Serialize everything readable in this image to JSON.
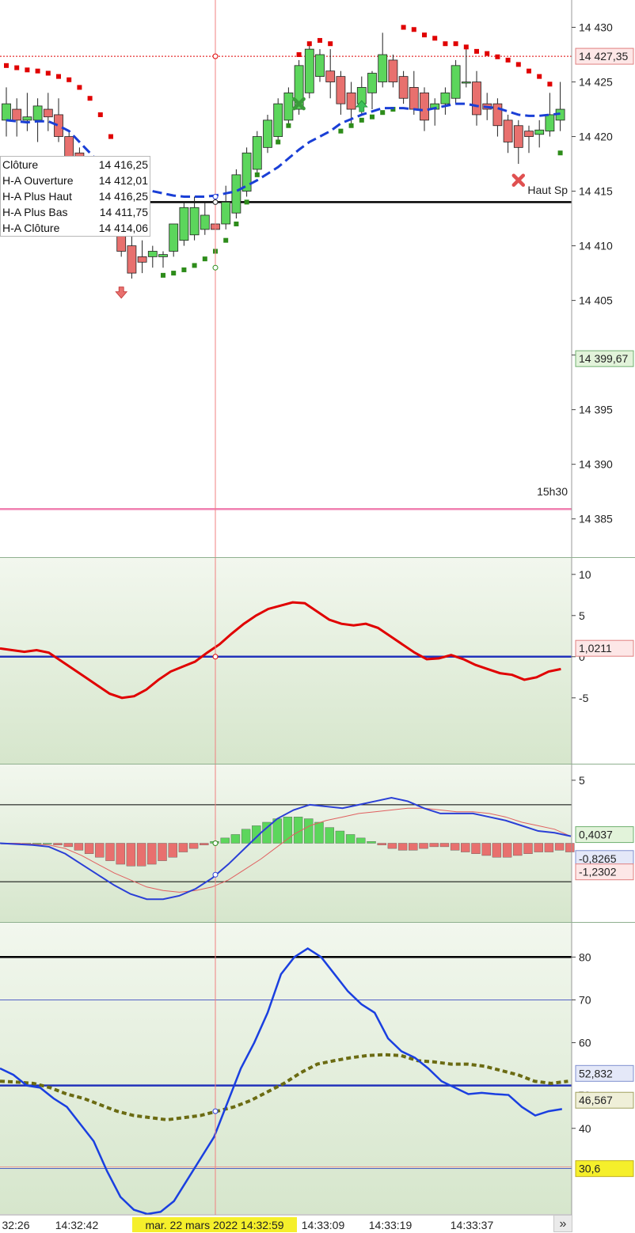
{
  "colors": {
    "bull": "#5cd65c",
    "bear": "#e8706e",
    "sar_bear": "#e00000",
    "sar_bull": "#2d8c1a",
    "ma": "#1a3fd6",
    "osc": "#e00000",
    "zero": "#2233bb",
    "pink": "#f080b0",
    "crosshair": "#f08080"
  },
  "price_panel": {
    "price_ticks": [
      "14 430",
      "14 425",
      "14 420",
      "14 415",
      "14 410",
      "14 405",
      "14 400",
      "14 395",
      "14 390",
      "14 385"
    ],
    "top_badge": "14 427,35",
    "mid_badge": "14 399,67",
    "pink_label": "15h30",
    "black_line_label": "Haut Sp"
  },
  "tooltip": {
    "rows": [
      {
        "label": "Clôture",
        "value": "14 416,25"
      },
      {
        "label": "H-A Ouverture",
        "value": "14 412,01"
      },
      {
        "label": "H-A Plus Haut",
        "value": "14 416,25"
      },
      {
        "label": "H-A Plus Bas",
        "value": "14 411,75"
      },
      {
        "label": "H-A Clôture",
        "value": "14 414,06"
      }
    ]
  },
  "osc_panel": {
    "ticks": [
      "10",
      "5",
      "0",
      "-5"
    ],
    "badge": "1,0211"
  },
  "macd_panel": {
    "ticks": [
      "5"
    ],
    "badge_green": "0,4037",
    "badge_blue": "-0,8265",
    "badge_red": "-1,2302"
  },
  "rsi_panel": {
    "ticks": [
      "80",
      "70",
      "60",
      "50",
      "40"
    ],
    "badge_blue": "52,832",
    "badge_olive": "46,567",
    "badge_yellow": "30,6",
    "level_label": "50"
  },
  "time_axis": {
    "labels": [
      "32:26",
      "14:32:42",
      "14:33:09",
      "14:33:19",
      "14:33:37"
    ],
    "crosshair_label": "mar. 22 mars 2022 14:32:59"
  },
  "nav": {
    "more_label": "»"
  },
  "chart_data": [
    {
      "type": "candlestick",
      "ylim": [
        14381.5,
        14432.5
      ],
      "candles": [
        {
          "o": 14421.5,
          "h": 14424.5,
          "l": 14420,
          "c": 14423
        },
        {
          "o": 14422.5,
          "h": 14423.5,
          "l": 14420,
          "c": 14421.5
        },
        {
          "o": 14421.5,
          "h": 14424,
          "l": 14420.5,
          "c": 14421.8
        },
        {
          "o": 14421.5,
          "h": 14423.5,
          "l": 14419.5,
          "c": 14422.8
        },
        {
          "o": 14422.5,
          "h": 14424,
          "l": 14420.5,
          "c": 14421.8
        },
        {
          "o": 14422,
          "h": 14423.5,
          "l": 14419.5,
          "c": 14420
        },
        {
          "o": 14420,
          "h": 14420.5,
          "l": 14415,
          "c": 14416.5
        },
        {
          "o": 14418.5,
          "h": 14419,
          "l": 14416,
          "c": 14416.2
        },
        {
          "o": 14417,
          "h": 14417.5,
          "l": 14413.5,
          "c": 14414
        },
        {
          "o": 14416,
          "h": 14416.5,
          "l": 14413,
          "c": 14413.5
        },
        {
          "o": 14414.5,
          "h": 14416,
          "l": 14413,
          "c": 14413.8
        },
        {
          "o": 14412,
          "h": 14413,
          "l": 14409,
          "c": 14409.5
        },
        {
          "o": 14410,
          "h": 14411,
          "l": 14407,
          "c": 14407.5
        },
        {
          "o": 14409,
          "h": 14410.5,
          "l": 14407.5,
          "c": 14408.5
        },
        {
          "o": 14409,
          "h": 14410,
          "l": 14408,
          "c": 14409.5
        },
        {
          "o": 14409,
          "h": 14409.5,
          "l": 14408,
          "c": 14409.2
        },
        {
          "o": 14409.5,
          "h": 14412,
          "l": 14409,
          "c": 14412
        },
        {
          "o": 14410.5,
          "h": 14414,
          "l": 14410,
          "c": 14413.5
        },
        {
          "o": 14411,
          "h": 14414.5,
          "l": 14410.5,
          "c": 14413.5
        },
        {
          "o": 14411.5,
          "h": 14414,
          "l": 14411,
          "c": 14412.8
        },
        {
          "o": 14412,
          "h": 14413,
          "l": 14409.5,
          "c": 14411.5
        },
        {
          "o": 14412,
          "h": 14415.5,
          "l": 14411.5,
          "c": 14414
        },
        {
          "o": 14413,
          "h": 14417,
          "l": 14412.5,
          "c": 14416.5
        },
        {
          "o": 14415,
          "h": 14419,
          "l": 14414.5,
          "c": 14418.5
        },
        {
          "o": 14417,
          "h": 14420.5,
          "l": 14416.5,
          "c": 14420
        },
        {
          "o": 14419,
          "h": 14422,
          "l": 14418.5,
          "c": 14421.5
        },
        {
          "o": 14420,
          "h": 14423.5,
          "l": 14419.5,
          "c": 14423
        },
        {
          "o": 14421.5,
          "h": 14424.5,
          "l": 14421,
          "c": 14424
        },
        {
          "o": 14422.5,
          "h": 14427,
          "l": 14422,
          "c": 14426.5
        },
        {
          "o": 14424,
          "h": 14428.5,
          "l": 14423.5,
          "c": 14428
        },
        {
          "o": 14425.5,
          "h": 14428,
          "l": 14425,
          "c": 14427.5
        },
        {
          "o": 14426,
          "h": 14428,
          "l": 14423.5,
          "c": 14425
        },
        {
          "o": 14425.5,
          "h": 14426,
          "l": 14422,
          "c": 14423
        },
        {
          "o": 14424,
          "h": 14425,
          "l": 14421,
          "c": 14422.5
        },
        {
          "o": 14423,
          "h": 14425.5,
          "l": 14422,
          "c": 14424.5
        },
        {
          "o": 14424,
          "h": 14426,
          "l": 14422.5,
          "c": 14425.8
        },
        {
          "o": 14425,
          "h": 14429.5,
          "l": 14424.5,
          "c": 14427.5
        },
        {
          "o": 14427,
          "h": 14427.5,
          "l": 14424.5,
          "c": 14425
        },
        {
          "o": 14425.5,
          "h": 14426,
          "l": 14423,
          "c": 14423.5
        },
        {
          "o": 14424.5,
          "h": 14426,
          "l": 14422,
          "c": 14422.5
        },
        {
          "o": 14424,
          "h": 14424.5,
          "l": 14420.5,
          "c": 14421.5
        },
        {
          "o": 14422.5,
          "h": 14423.5,
          "l": 14421,
          "c": 14423
        },
        {
          "o": 14423,
          "h": 14424.5,
          "l": 14422,
          "c": 14424
        },
        {
          "o": 14423.5,
          "h": 14427,
          "l": 14423,
          "c": 14426.5
        },
        {
          "o": 14425,
          "h": 14428,
          "l": 14424.5,
          "c": 14425
        },
        {
          "o": 14425,
          "h": 14426,
          "l": 14421,
          "c": 14422
        },
        {
          "o": 14423,
          "h": 14424,
          "l": 14421.5,
          "c": 14422.5
        },
        {
          "o": 14423,
          "h": 14423.5,
          "l": 14420,
          "c": 14421
        },
        {
          "o": 14421.5,
          "h": 14422,
          "l": 14418.5,
          "c": 14419.5
        },
        {
          "o": 14421,
          "h": 14421.5,
          "l": 14417.5,
          "c": 14419
        },
        {
          "o": 14420.5,
          "h": 14421,
          "l": 14418.5,
          "c": 14420
        },
        {
          "o": 14420.2,
          "h": 14421.5,
          "l": 14419,
          "c": 14420.6
        },
        {
          "o": 14420.5,
          "h": 14424,
          "l": 14420,
          "c": 14422
        },
        {
          "o": 14421.5,
          "h": 14425,
          "l": 14420.5,
          "c": 14422.5
        }
      ],
      "sar": [
        {
          "i": 0,
          "v": 14426.5,
          "s": "bear"
        },
        {
          "i": 1,
          "v": 14426.3,
          "s": "bear"
        },
        {
          "i": 2,
          "v": 14426.1,
          "s": "bear"
        },
        {
          "i": 3,
          "v": 14426,
          "s": "bear"
        },
        {
          "i": 4,
          "v": 14425.8,
          "s": "bear"
        },
        {
          "i": 5,
          "v": 14425.5,
          "s": "bear"
        },
        {
          "i": 6,
          "v": 14425.2,
          "s": "bear"
        },
        {
          "i": 7,
          "v": 14424.5,
          "s": "bear"
        },
        {
          "i": 8,
          "v": 14423.5,
          "s": "bear"
        },
        {
          "i": 9,
          "v": 14422,
          "s": "bear"
        },
        {
          "i": 10,
          "v": 14420,
          "s": "bear"
        },
        {
          "i": 11,
          "v": 14418,
          "s": "bear"
        },
        {
          "i": 12,
          "v": 14416,
          "s": "bear"
        },
        {
          "i": 13,
          "v": 14414.5,
          "s": "bear"
        },
        {
          "i": 15,
          "v": 14407.3,
          "s": "bull"
        },
        {
          "i": 16,
          "v": 14407.5,
          "s": "bull"
        },
        {
          "i": 17,
          "v": 14407.8,
          "s": "bull"
        },
        {
          "i": 18,
          "v": 14408.2,
          "s": "bull"
        },
        {
          "i": 19,
          "v": 14408.8,
          "s": "bull"
        },
        {
          "i": 20,
          "v": 14409.5,
          "s": "bull"
        },
        {
          "i": 21,
          "v": 14410.5,
          "s": "bull"
        },
        {
          "i": 22,
          "v": 14412,
          "s": "bull"
        },
        {
          "i": 23,
          "v": 14414,
          "s": "bull"
        },
        {
          "i": 24,
          "v": 14416.5,
          "s": "bull"
        },
        {
          "i": 26,
          "v": 14419.5,
          "s": "bull"
        },
        {
          "i": 27,
          "v": 14421,
          "s": "bull"
        },
        {
          "i": 28,
          "v": 14427.5,
          "s": "bear"
        },
        {
          "i": 29,
          "v": 14428.5,
          "s": "bear"
        },
        {
          "i": 30,
          "v": 14428.8,
          "s": "bear"
        },
        {
          "i": 31,
          "v": 14428.5,
          "s": "bear"
        },
        {
          "i": 32,
          "v": 14420.5,
          "s": "bull"
        },
        {
          "i": 33,
          "v": 14421,
          "s": "bull"
        },
        {
          "i": 34,
          "v": 14421.5,
          "s": "bull"
        },
        {
          "i": 35,
          "v": 14421.8,
          "s": "bull"
        },
        {
          "i": 36,
          "v": 14422.2,
          "s": "bull"
        },
        {
          "i": 37,
          "v": 14422.5,
          "s": "bull"
        },
        {
          "i": 38,
          "v": 14430,
          "s": "bear"
        },
        {
          "i": 39,
          "v": 14429.8,
          "s": "bear"
        },
        {
          "i": 40,
          "v": 14429.3,
          "s": "bear"
        },
        {
          "i": 41,
          "v": 14429,
          "s": "bear"
        },
        {
          "i": 42,
          "v": 14428.5,
          "s": "bear"
        },
        {
          "i": 43,
          "v": 14428.5,
          "s": "bear"
        },
        {
          "i": 44,
          "v": 14428.2,
          "s": "bear"
        },
        {
          "i": 45,
          "v": 14427.8,
          "s": "bear"
        },
        {
          "i": 46,
          "v": 14427.6,
          "s": "bear"
        },
        {
          "i": 47,
          "v": 14427.3,
          "s": "bear"
        },
        {
          "i": 48,
          "v": 14427,
          "s": "bear"
        },
        {
          "i": 49,
          "v": 14426.6,
          "s": "bear"
        },
        {
          "i": 50,
          "v": 14426,
          "s": "bear"
        },
        {
          "i": 51,
          "v": 14425.5,
          "s": "bear"
        },
        {
          "i": 52,
          "v": 14424.8,
          "s": "bear"
        },
        {
          "i": 53,
          "v": 14418.5,
          "s": "bull"
        }
      ],
      "ma": [
        14421.5,
        14421.4,
        14421.3,
        14421.4,
        14421.4,
        14421,
        14420.5,
        14419.5,
        14418.5,
        14417.5,
        14416.5,
        14415.8,
        14415.5,
        14415.2,
        14415,
        14414.8,
        14414.6,
        14414.5,
        14414.5,
        14414.5,
        14414.6,
        14414.8,
        14415,
        14415.5,
        14416,
        14416.6,
        14417.2,
        14418,
        14418.8,
        14419.5,
        14420,
        14420.5,
        14421.2,
        14421.6,
        14422,
        14422.3,
        14422.6,
        14422.6,
        14422.6,
        14422.5,
        14422.4,
        14422.6,
        14422.8,
        14423,
        14423,
        14422.8,
        14422.7,
        14422.6,
        14422.3,
        14422,
        14421.9,
        14421.9,
        14422,
        14422.1
      ],
      "markers": [
        {
          "type": "arrow-down",
          "i": 11,
          "v": 14405.5,
          "color": "bear"
        },
        {
          "type": "cross",
          "i": 28,
          "v": 14423,
          "color": "bull"
        },
        {
          "type": "arrow-up",
          "i": 34,
          "v": 14423,
          "color": "bull"
        },
        {
          "type": "cross",
          "i": 49,
          "v": 14416,
          "color": "bear"
        }
      ],
      "black_level": 14414,
      "top_level": 14427.35,
      "pink_level": 14385.9
    },
    {
      "type": "line",
      "ylim": [
        -13,
        12
      ],
      "series": [
        {
          "values": [
            1,
            0.8,
            0.6,
            0.8,
            0.5,
            -0.5,
            -1.5,
            -2.5,
            -3.5,
            -4.5,
            -5,
            -4.8,
            -4,
            -2.8,
            -1.8,
            -1.2,
            -0.6,
            0.5,
            1.5,
            2.8,
            4,
            5,
            5.8,
            6.2,
            6.6,
            6.5,
            5.5,
            4.5,
            4,
            3.8,
            4,
            3.5,
            2.5,
            1.5,
            0.5,
            -0.3,
            -0.2,
            0.2,
            -0.3,
            -1,
            -1.5,
            -2,
            -2.2,
            -2.8,
            -2.5,
            -1.8,
            -1.5
          ]
        }
      ]
    },
    {
      "type": "bar",
      "ylim": [
        -4.5,
        4.5
      ],
      "histogram": [
        0,
        0,
        0,
        0,
        0,
        -0.1,
        -0.2,
        -0.4,
        -0.6,
        -0.8,
        -1.0,
        -1.2,
        -1.3,
        -1.3,
        -1.2,
        -1.0,
        -0.8,
        -0.5,
        -0.3,
        -0.1,
        0.1,
        0.3,
        0.5,
        0.8,
        1.0,
        1.2,
        1.4,
        1.5,
        1.5,
        1.4,
        1.2,
        0.9,
        0.7,
        0.5,
        0.3,
        0.1,
        -0.1,
        -0.3,
        -0.4,
        -0.4,
        -0.3,
        -0.2,
        -0.2,
        -0.4,
        -0.5,
        -0.6,
        -0.7,
        -0.8,
        -0.8,
        -0.7,
        -0.6,
        -0.5,
        -0.5,
        -0.4,
        -0.5
      ],
      "series": [
        {
          "values": [
            0,
            -0.05,
            -0.1,
            -0.2,
            -0.6,
            -1.2,
            -1.8,
            -2.4,
            -2.9,
            -3.2,
            -3.2,
            -3.0,
            -2.6,
            -2.0,
            -1.2,
            -0.3,
            0.6,
            1.4,
            1.9,
            2.2,
            2.1,
            2.0,
            2.2,
            2.4,
            2.6,
            2.4,
            2.0,
            1.7,
            1.7,
            1.7,
            1.5,
            1.3,
            1.0,
            0.7,
            0.6,
            0.4
          ]
        },
        {
          "values": [
            0,
            0,
            -0.05,
            -0.1,
            -0.3,
            -0.7,
            -1.2,
            -1.7,
            -2.1,
            -2.5,
            -2.7,
            -2.8,
            -2.7,
            -2.5,
            -2.1,
            -1.5,
            -0.9,
            -0.2,
            0.5,
            1.0,
            1.3,
            1.5,
            1.7,
            1.8,
            1.9,
            2.0,
            2.0,
            1.9,
            1.8,
            1.8,
            1.7,
            1.5,
            1.2,
            1.0,
            0.8,
            0.4
          ]
        }
      ]
    },
    {
      "type": "line",
      "ylim": [
        20,
        88
      ],
      "series": [
        {
          "values": [
            54,
            52.5,
            50,
            49.5,
            47,
            45,
            41,
            37,
            30,
            24,
            21,
            20,
            20.5,
            23,
            28,
            33,
            38,
            46,
            54,
            60,
            67,
            76,
            80,
            82,
            80,
            76,
            72,
            69,
            67,
            61,
            58,
            56.5,
            54,
            51,
            49.5,
            48,
            48.3,
            48,
            47.8,
            45,
            43,
            44,
            44.5
          ]
        },
        {
          "values": [
            51,
            50.8,
            50.5,
            49.5,
            48,
            47,
            45.5,
            44,
            43,
            42.5,
            42,
            42.5,
            43,
            44,
            45,
            46.5,
            48.5,
            50.5,
            53,
            55,
            55.8,
            56.5,
            57,
            57.2,
            57,
            55.8,
            55.5,
            55,
            55,
            54.5,
            53.5,
            52.5,
            51,
            50.5,
            51
          ]
        }
      ],
      "levels": [
        80,
        70,
        50,
        30.6
      ]
    }
  ]
}
